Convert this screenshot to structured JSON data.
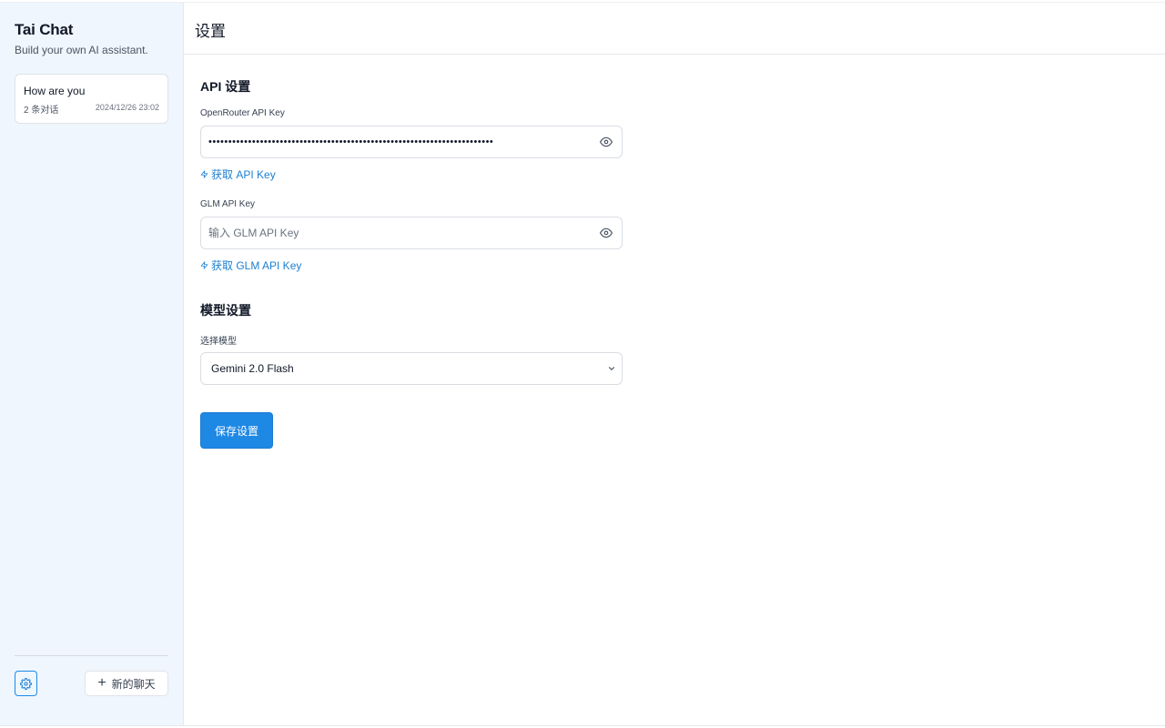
{
  "sidebar": {
    "app_title": "Tai Chat",
    "app_subtitle": "Build your own AI assistant.",
    "chats": [
      {
        "title": "How are you",
        "count": "2 条对话",
        "time": "2024/12/26 23:02"
      }
    ],
    "settings_icon": "gear-icon",
    "new_chat_label": "新的聊天"
  },
  "header": {
    "title": "设置"
  },
  "api_section": {
    "title": "API 设置",
    "openrouter": {
      "label": "OpenRouter API Key",
      "value": "••••••••••••••••••••••••••••••••••••••••••••••••••••••••••••••••••••••••",
      "link": "获取 API Key"
    },
    "glm": {
      "label": "GLM API Key",
      "value": "",
      "placeholder": "输入 GLM API Key",
      "link": "获取 GLM API Key"
    }
  },
  "model_section": {
    "title": "模型设置",
    "label": "选择模型",
    "selected": "Gemini 2.0 Flash"
  },
  "save_label": "保存设置",
  "colors": {
    "accent": "#1e88e5",
    "link": "#1d7fd1",
    "sidebar_bg": "#eff6fd"
  }
}
